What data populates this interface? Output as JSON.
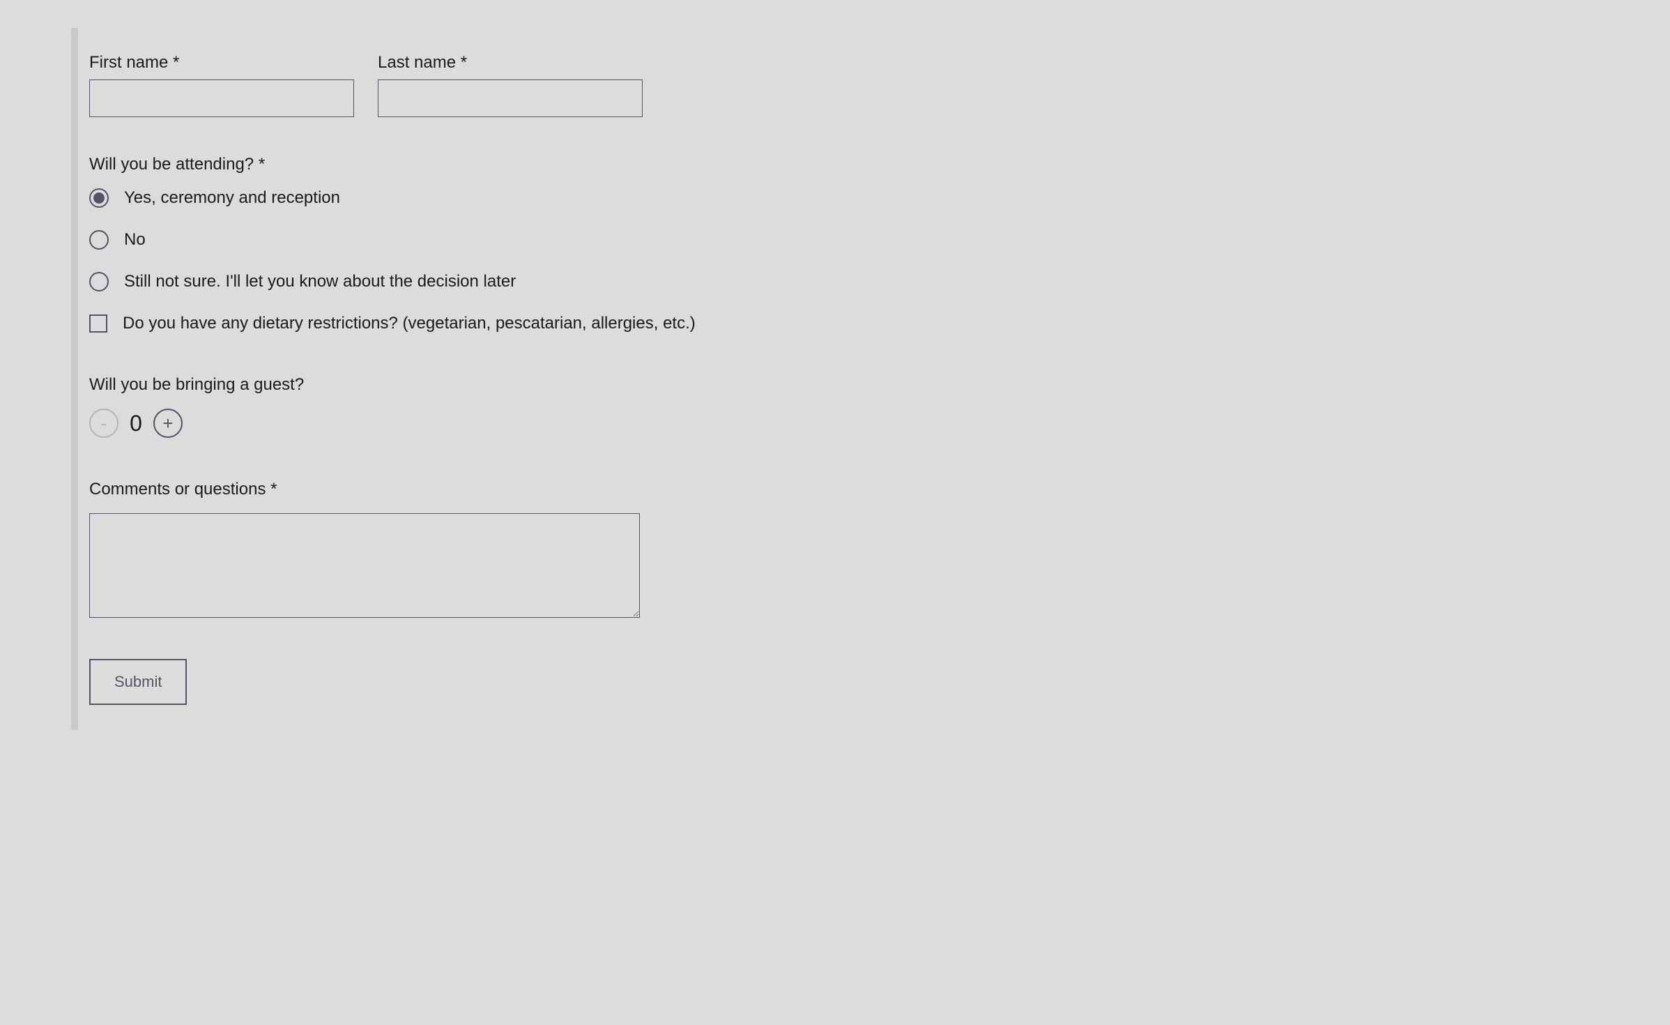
{
  "form": {
    "first_name": {
      "label": "First name *",
      "value": ""
    },
    "last_name": {
      "label": "Last name *",
      "value": ""
    },
    "attending": {
      "label": "Will you be attending? *",
      "options": [
        "Yes, ceremony and reception",
        "No",
        "Still not sure. I'll let you know about the decision later"
      ],
      "selected_index": 0
    },
    "dietary": {
      "label": "Do you have any dietary restrictions? (vegetarian, pescatarian, allergies, etc.)",
      "checked": false
    },
    "guest": {
      "label": "Will you be bringing a guest?",
      "value": "0",
      "minus": "-",
      "plus": "+"
    },
    "comments": {
      "label": "Comments or questions *",
      "value": ""
    },
    "submit_label": "Submit"
  }
}
